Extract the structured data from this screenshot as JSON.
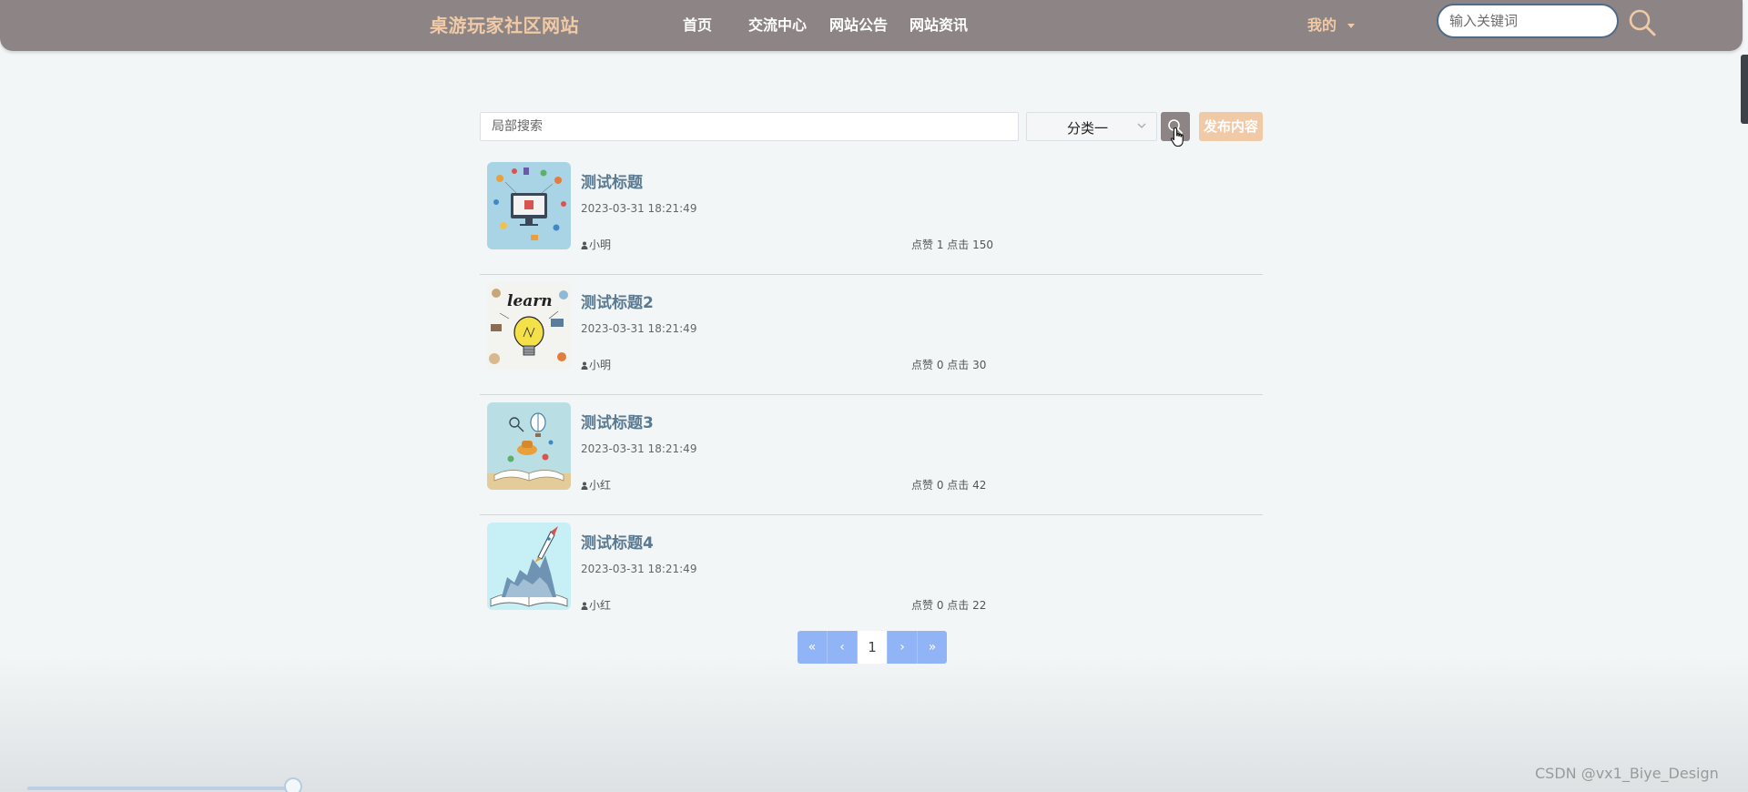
{
  "navbar": {
    "brand": "桌游玩家社区网站",
    "links": [
      "首页",
      "交流中心",
      "网站公告",
      "网站资讯"
    ],
    "mine_label": "我的",
    "search_placeholder": "输入关键词",
    "search_icon": "search-icon"
  },
  "toolbar": {
    "local_search_placeholder": "局部搜索",
    "category_value": "分类一",
    "search_button_icon": "search-icon",
    "publish_label": "发布内容"
  },
  "posts": [
    {
      "title": "测试标题",
      "time": "2023-03-31 18:21:49",
      "author": "小明",
      "stats": "点赞 1 点击 150",
      "image": "digital-marketing-illustration"
    },
    {
      "title": "测试标题2",
      "time": "2023-03-31 18:21:49",
      "author": "小明",
      "stats": "点赞 0 点击 30",
      "image": "learn-lightbulb-illustration"
    },
    {
      "title": "测试标题3",
      "time": "2023-03-31 18:21:49",
      "author": "小红",
      "stats": "点赞 0 点击 42",
      "image": "open-book-balloon-illustration"
    },
    {
      "title": "测试标题4",
      "time": "2023-03-31 18:21:49",
      "author": "小红",
      "stats": "点赞 0 点击 22",
      "image": "open-book-rocket-illustration"
    }
  ],
  "pagination": {
    "first": "«",
    "prev": "‹",
    "current": "1",
    "next": "›",
    "last": "»"
  },
  "watermark": "CSDN @vx1_Biye_Design",
  "colors": {
    "navbar_bg": "#8d8585",
    "brand": "#f0c9a6",
    "title": "#5a7a92",
    "pagination": "#90b4f5",
    "publish": "#f0c9a6"
  }
}
